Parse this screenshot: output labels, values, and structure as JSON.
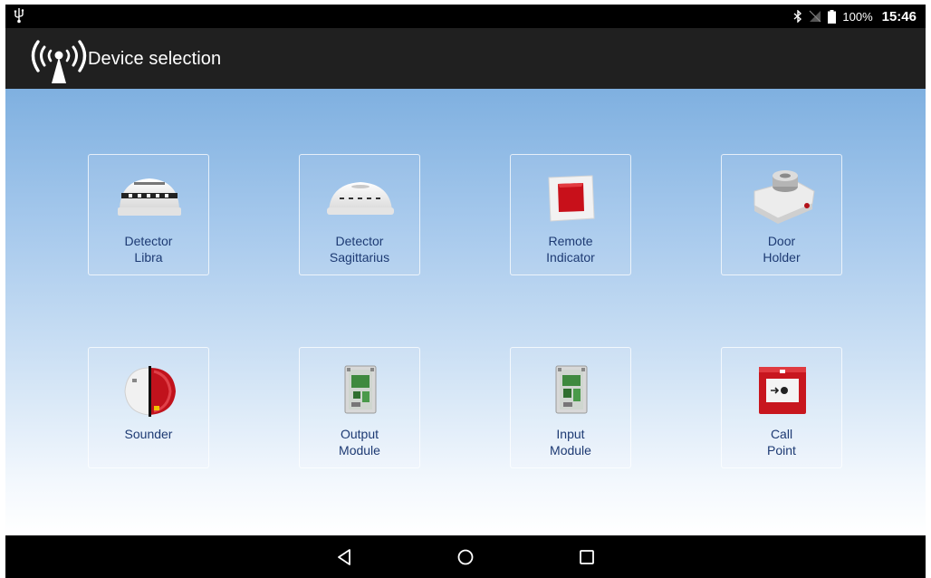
{
  "status_bar": {
    "usb_icon": "usb-icon",
    "bluetooth_icon": "bluetooth-icon",
    "signal_icon": "no-signal-icon",
    "battery_icon": "battery-icon",
    "battery_percent": "100%",
    "time": "15:46"
  },
  "app_bar": {
    "logo_icon": "wireless-antenna-icon",
    "title": "Device selection"
  },
  "devices": [
    {
      "line1": "Detector",
      "line2": "Libra",
      "icon": "detector-libra-icon"
    },
    {
      "line1": "Detector",
      "line2": "Sagittarius",
      "icon": "detector-sagittarius-icon"
    },
    {
      "line1": "Remote",
      "line2": "Indicator",
      "icon": "remote-indicator-icon"
    },
    {
      "line1": "Door",
      "line2": "Holder",
      "icon": "door-holder-icon"
    },
    {
      "line1": "Sounder",
      "line2": "",
      "icon": "sounder-icon"
    },
    {
      "line1": "Output",
      "line2": "Module",
      "icon": "output-module-icon"
    },
    {
      "line1": "Input",
      "line2": "Module",
      "icon": "input-module-icon"
    },
    {
      "line1": "Call",
      "line2": "Point",
      "icon": "call-point-icon"
    }
  ],
  "nav_bar": {
    "back_icon": "back-icon",
    "home_icon": "home-icon",
    "recents_icon": "recents-icon"
  },
  "colors": {
    "app_bar_bg": "#202020",
    "label_text": "#1d3a73",
    "gradient_top": "#7fb0e0",
    "gradient_bottom": "#ffffff"
  }
}
